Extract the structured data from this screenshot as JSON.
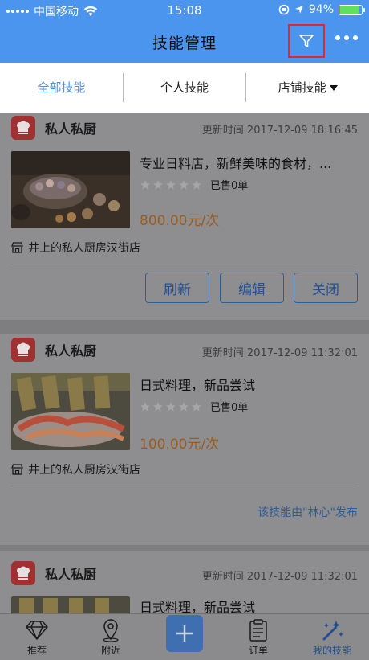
{
  "status_bar": {
    "carrier": "中国移动",
    "time": "15:08",
    "battery": "94%"
  },
  "nav": {
    "title": "技能管理"
  },
  "tabs": [
    {
      "label": "全部技能"
    },
    {
      "label": "个人技能"
    },
    {
      "label": "店铺技能"
    }
  ],
  "cards": [
    {
      "shop_name": "私人私厨",
      "updated": "更新时间 2017-12-09 18:16:45",
      "title": "专业日料店，新鲜美味的食材，...",
      "sold": "已售0单",
      "price": "800.00元/次",
      "location": "井上的私人厨房汉街店",
      "buttons": {
        "refresh": "刷新",
        "edit": "编辑",
        "close": "关闭"
      }
    },
    {
      "shop_name": "私人私厨",
      "updated": "更新时间 2017-12-09 11:32:01",
      "title": "日式料理，新品尝试",
      "sold": "已售0单",
      "price": "100.00元/次",
      "location": "井上的私人厨房汉街店",
      "publisher": "该技能由\"林心\"发布"
    },
    {
      "shop_name": "私人私厨",
      "updated": "更新时间 2017-12-09 11:32:01",
      "title": "日式料理，新品尝试"
    }
  ],
  "tabbar": [
    {
      "label": "推荐",
      "icon": "diamond-icon"
    },
    {
      "label": "附近",
      "icon": "location-pin-icon"
    },
    {
      "label": "",
      "icon": "plus-icon"
    },
    {
      "label": "订单",
      "icon": "order-list-icon"
    },
    {
      "label": "我的技能",
      "icon": "magic-wand-icon"
    }
  ],
  "colors": {
    "accent": "#4b95ee",
    "highlight_border": "#e0282f"
  }
}
